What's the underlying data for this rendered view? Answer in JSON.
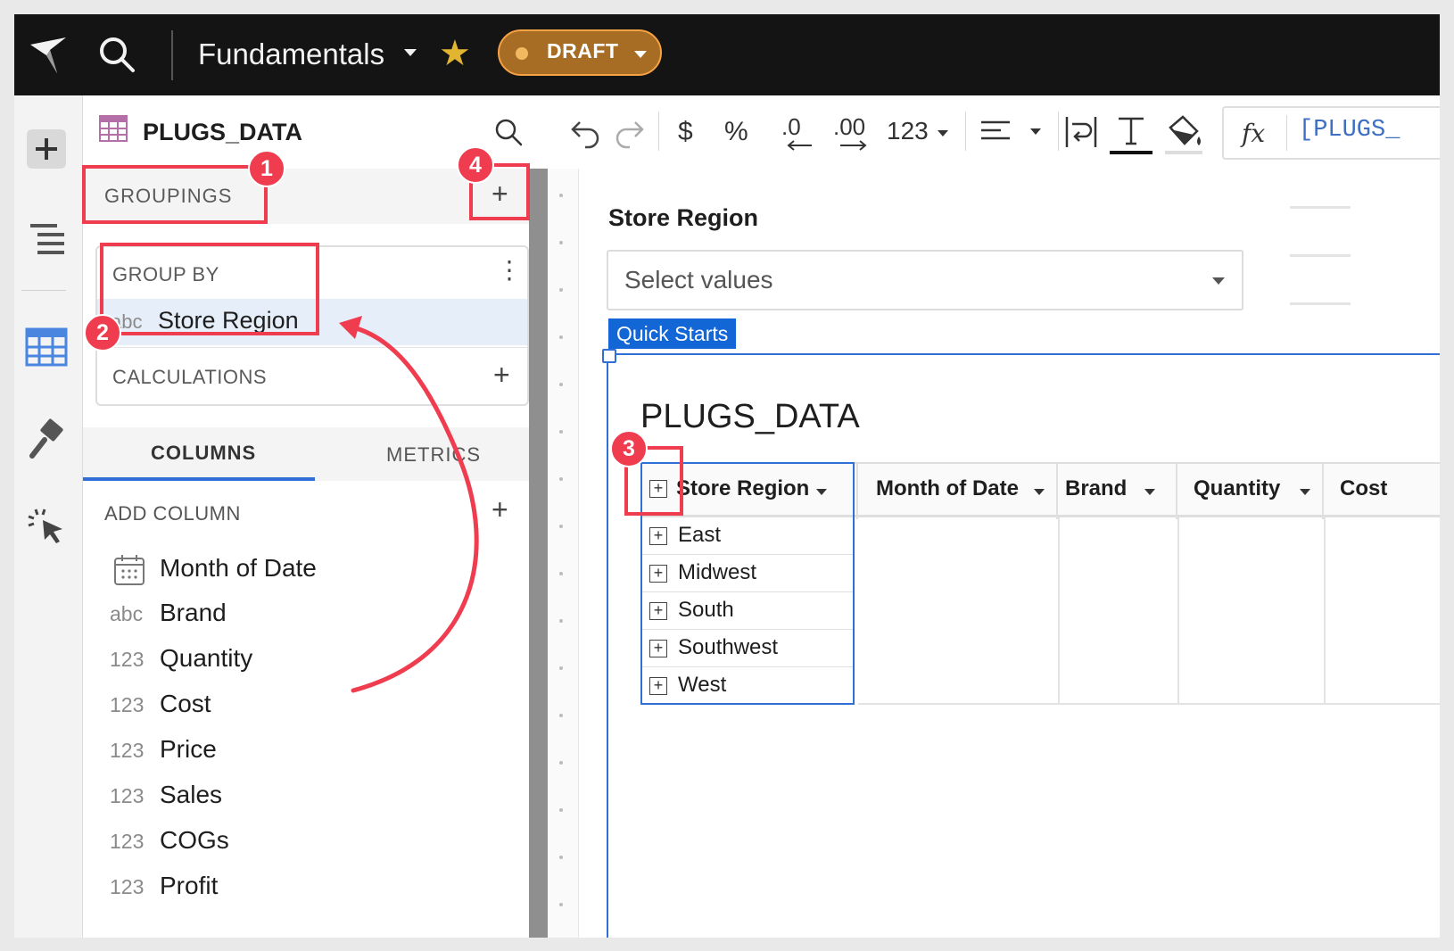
{
  "topbar": {
    "workbook_title": "Fundamentals",
    "status_label": "DRAFT",
    "accent_color": "#f5a243"
  },
  "panel": {
    "title": "PLUGS_DATA",
    "groupings_label": "GROUPINGS",
    "group_by_label": "GROUP BY",
    "group_by_item": {
      "type": "abc",
      "name": "Store Region"
    },
    "calculations_label": "CALCULATIONS",
    "tabs": [
      {
        "label": "COLUMNS",
        "active": true
      },
      {
        "label": "METRICS",
        "active": false
      }
    ],
    "add_column_label": "ADD COLUMN",
    "columns": [
      {
        "type": "date",
        "name": "Month of Date"
      },
      {
        "type": "abc",
        "name": "Brand"
      },
      {
        "type": "123",
        "name": "Quantity"
      },
      {
        "type": "123",
        "name": "Cost"
      },
      {
        "type": "123",
        "name": "Price"
      },
      {
        "type": "123",
        "name": "Sales"
      },
      {
        "type": "123",
        "name": "COGs"
      },
      {
        "type": "123",
        "name": "Profit"
      }
    ]
  },
  "toolbar": {
    "currency_symbol": "$",
    "percent_symbol": "%",
    "decrease_decimals": ".0",
    "increase_decimals": ".00",
    "number_format": "123",
    "formula_label": "fx",
    "formula_text": "[PLUGS_"
  },
  "canvas": {
    "control_title": "Store Region",
    "control_placeholder": "Select values",
    "element_tag": "Quick Starts",
    "element_title": "PLUGS_DATA",
    "table": {
      "headers": [
        "Store Region",
        "Month of Date",
        "Brand",
        "Quantity",
        "Cost"
      ],
      "rows": [
        "East",
        "Midwest",
        "South",
        "Southwest",
        "West"
      ]
    }
  },
  "annotations": {
    "badges": [
      "1",
      "2",
      "3",
      "4"
    ],
    "color": "#ef3c4f"
  }
}
